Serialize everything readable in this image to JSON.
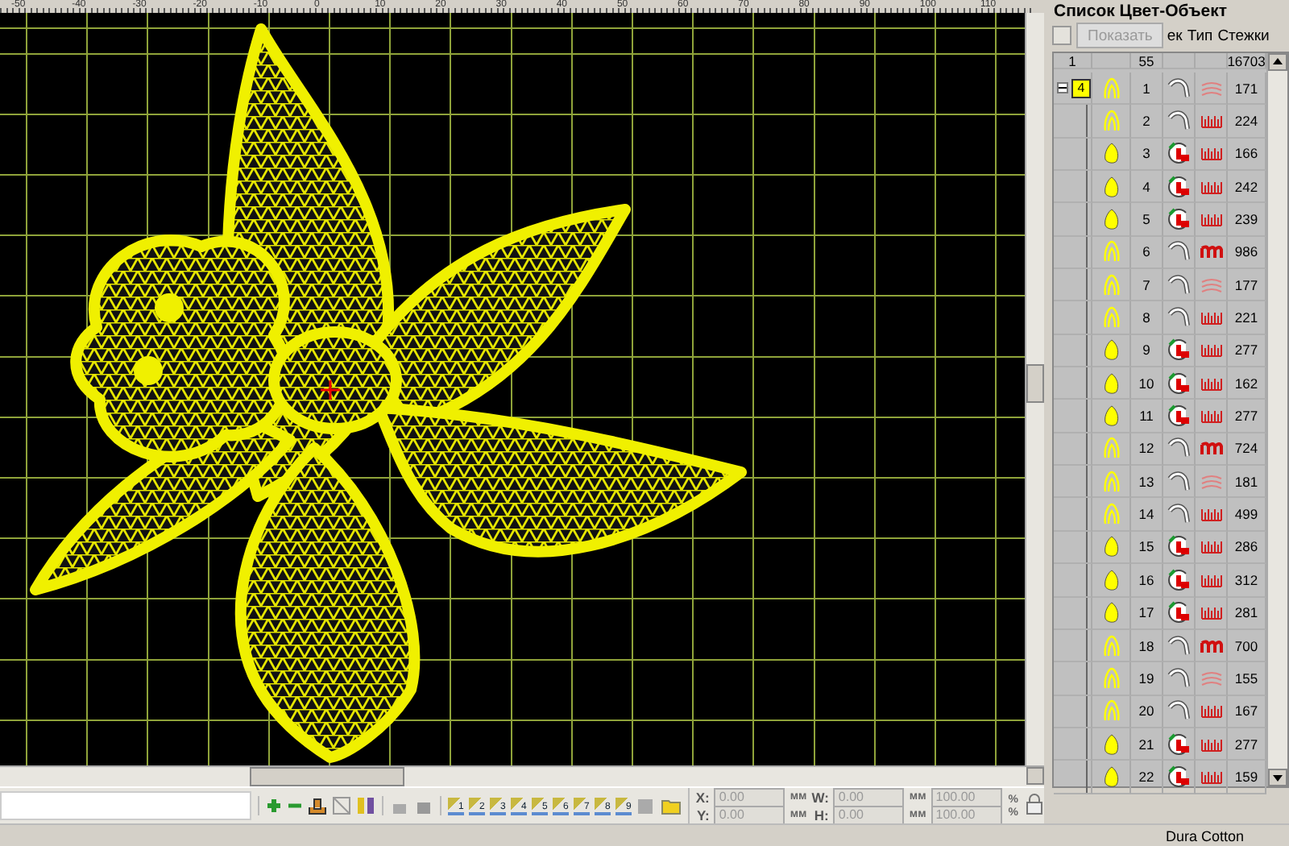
{
  "ruler": {
    "labels": [
      "-50",
      "-40",
      "-30",
      "-20",
      "-10",
      "0",
      "10",
      "20",
      "30",
      "40",
      "50",
      "60",
      "70",
      "80",
      "90",
      "100",
      "110"
    ]
  },
  "panel": {
    "title": "Список Цвет-Объект",
    "show_button": {
      "label": "Показать",
      "disabled": true
    },
    "columns": [
      "ек",
      "Тип",
      "Стежки"
    ],
    "summary": [
      "1",
      "55",
      "16703"
    ],
    "group": {
      "label": "4",
      "color": "#ffff00",
      "expanded": true
    },
    "rows": [
      {
        "number": "1",
        "thumb": {
          "kind": "outline"
        },
        "object": {
          "kind": "satin"
        },
        "pattern": {
          "kind": "wave"
        },
        "stitches": "171"
      },
      {
        "number": "2",
        "thumb": {
          "kind": "outline"
        },
        "object": {
          "kind": "satin"
        },
        "pattern": {
          "kind": "zigzag"
        },
        "stitches": "224"
      },
      {
        "number": "3",
        "thumb": {
          "kind": "solid"
        },
        "object": {
          "kind": "fill"
        },
        "pattern": {
          "kind": "zigzag"
        },
        "stitches": "166"
      },
      {
        "number": "4",
        "thumb": {
          "kind": "solid"
        },
        "object": {
          "kind": "fill"
        },
        "pattern": {
          "kind": "zigzag"
        },
        "stitches": "242"
      },
      {
        "number": "5",
        "thumb": {
          "kind": "solid"
        },
        "object": {
          "kind": "fill"
        },
        "pattern": {
          "kind": "zigzag"
        },
        "stitches": "239"
      },
      {
        "number": "6",
        "thumb": {
          "kind": "outline"
        },
        "object": {
          "kind": "satin"
        },
        "pattern": {
          "kind": "dense"
        },
        "stitches": "986"
      },
      {
        "number": "7",
        "thumb": {
          "kind": "outline"
        },
        "object": {
          "kind": "satin"
        },
        "pattern": {
          "kind": "wave"
        },
        "stitches": "177"
      },
      {
        "number": "8",
        "thumb": {
          "kind": "outline"
        },
        "object": {
          "kind": "satin"
        },
        "pattern": {
          "kind": "zigzag"
        },
        "stitches": "221"
      },
      {
        "number": "9",
        "thumb": {
          "kind": "solid"
        },
        "object": {
          "kind": "fill"
        },
        "pattern": {
          "kind": "zigzag"
        },
        "stitches": "277"
      },
      {
        "number": "10",
        "thumb": {
          "kind": "solid"
        },
        "object": {
          "kind": "fill"
        },
        "pattern": {
          "kind": "zigzag"
        },
        "stitches": "162"
      },
      {
        "number": "11",
        "thumb": {
          "kind": "solid"
        },
        "object": {
          "kind": "fill"
        },
        "pattern": {
          "kind": "zigzag"
        },
        "stitches": "277"
      },
      {
        "number": "12",
        "thumb": {
          "kind": "outline"
        },
        "object": {
          "kind": "satin"
        },
        "pattern": {
          "kind": "dense"
        },
        "stitches": "724"
      },
      {
        "number": "13",
        "thumb": {
          "kind": "outline"
        },
        "object": {
          "kind": "satin"
        },
        "pattern": {
          "kind": "wave"
        },
        "stitches": "181"
      },
      {
        "number": "14",
        "thumb": {
          "kind": "outline"
        },
        "object": {
          "kind": "satin"
        },
        "pattern": {
          "kind": "zigzag"
        },
        "stitches": "499"
      },
      {
        "number": "15",
        "thumb": {
          "kind": "solid"
        },
        "object": {
          "kind": "fill"
        },
        "pattern": {
          "kind": "zigzag"
        },
        "stitches": "286"
      },
      {
        "number": "16",
        "thumb": {
          "kind": "solid"
        },
        "object": {
          "kind": "fill"
        },
        "pattern": {
          "kind": "zigzag"
        },
        "stitches": "312"
      },
      {
        "number": "17",
        "thumb": {
          "kind": "solid"
        },
        "object": {
          "kind": "fill"
        },
        "pattern": {
          "kind": "zigzag"
        },
        "stitches": "281"
      },
      {
        "number": "18",
        "thumb": {
          "kind": "outline"
        },
        "object": {
          "kind": "satin"
        },
        "pattern": {
          "kind": "dense"
        },
        "stitches": "700"
      },
      {
        "number": "19",
        "thumb": {
          "kind": "outline"
        },
        "object": {
          "kind": "satin"
        },
        "pattern": {
          "kind": "wave"
        },
        "stitches": "155"
      },
      {
        "number": "20",
        "thumb": {
          "kind": "outline"
        },
        "object": {
          "kind": "satin"
        },
        "pattern": {
          "kind": "zigzag"
        },
        "stitches": "167"
      },
      {
        "number": "21",
        "thumb": {
          "kind": "solid"
        },
        "object": {
          "kind": "fill"
        },
        "pattern": {
          "kind": "zigzag"
        },
        "stitches": "277"
      },
      {
        "number": "22",
        "thumb": {
          "kind": "solid"
        },
        "object": {
          "kind": "fill"
        },
        "pattern": {
          "kind": "zigzag"
        },
        "stitches": "159"
      }
    ]
  },
  "toolbar": {
    "fields": [
      {
        "label": "X:",
        "value": "0.00",
        "unit": "мм",
        "disabled": true
      },
      {
        "label": "Y:",
        "value": "0.00",
        "unit": "мм",
        "disabled": true
      },
      {
        "label": "W:",
        "value": "0.00",
        "unit": "мм",
        "disabled": true
      },
      {
        "label": "H:",
        "value": "0.00",
        "unit": "мм",
        "disabled": true
      }
    ],
    "scales": [
      {
        "value": "100.00",
        "unit": "%",
        "disabled": true
      },
      {
        "value": "100.00",
        "unit": "%",
        "disabled": true
      }
    ],
    "color_buttons": [
      "1",
      "2",
      "3",
      "4",
      "5",
      "6",
      "7",
      "8",
      "9"
    ]
  },
  "status_bar": {
    "thread": "Dura Cotton"
  }
}
